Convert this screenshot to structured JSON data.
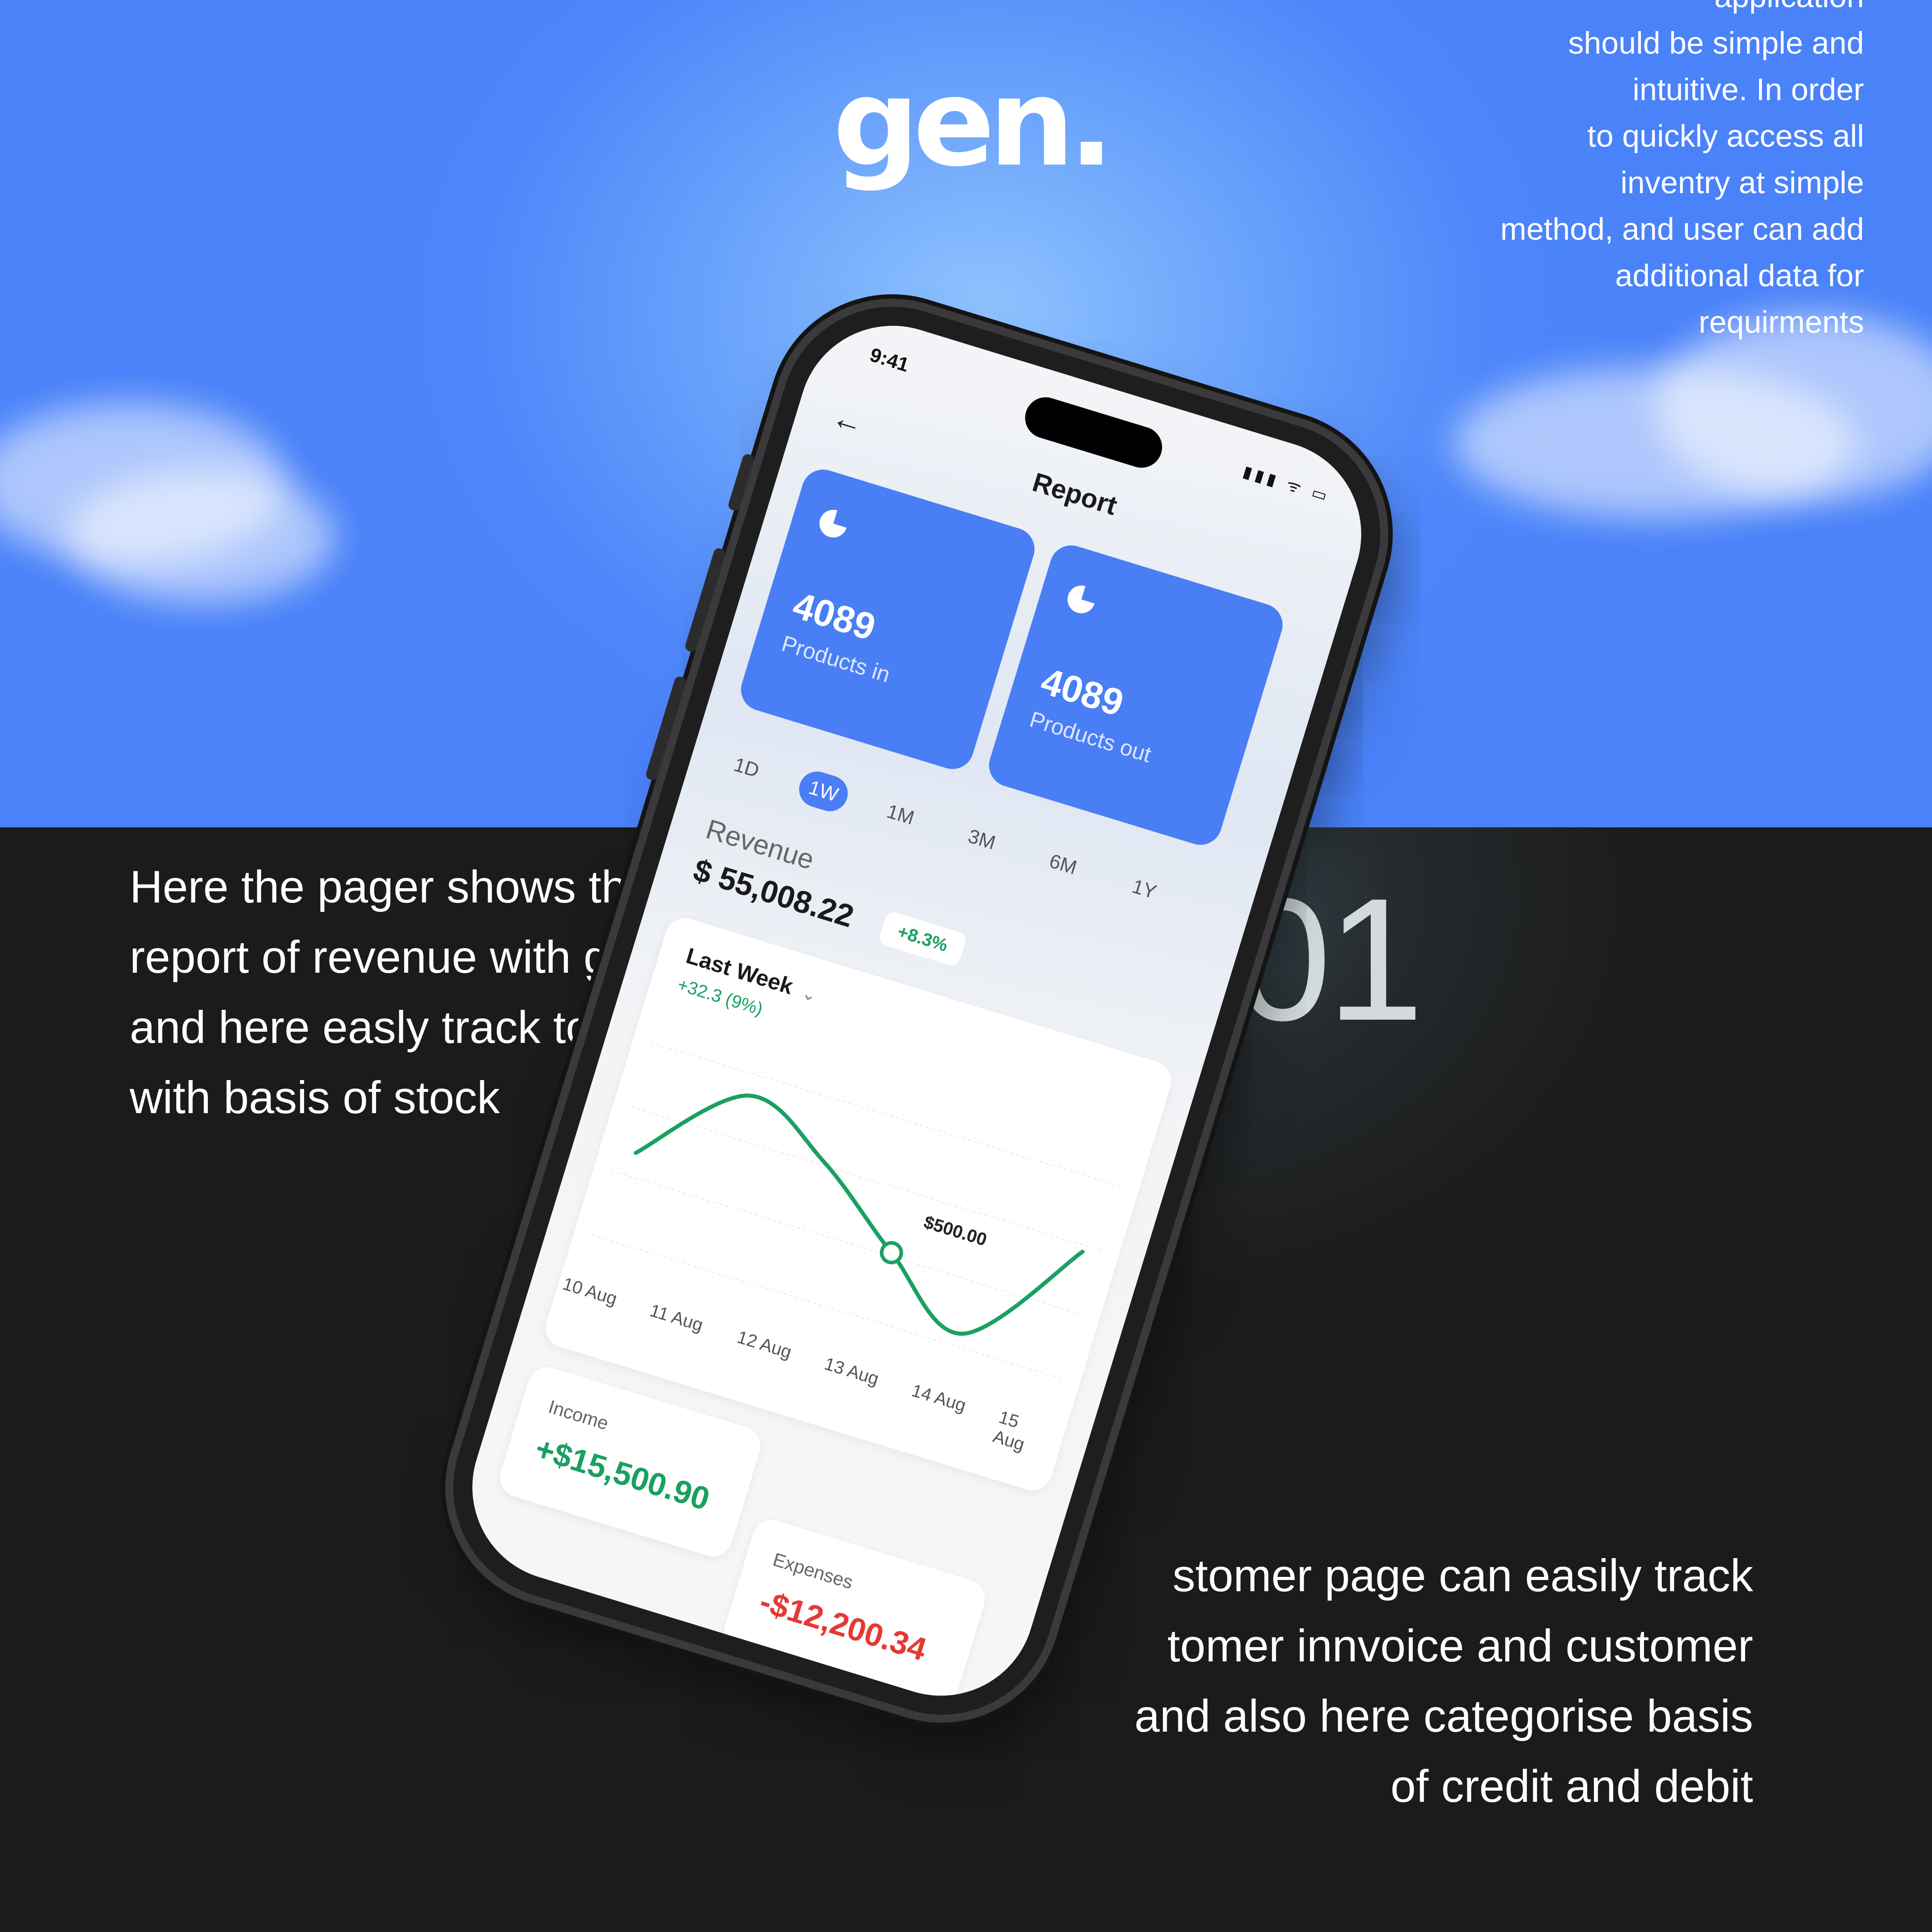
{
  "brand": {
    "logo_text": "gen."
  },
  "intro_blurb": {
    "lines": [
      "application",
      "should be simple and",
      "intuitive. In order",
      "to quickly access all",
      "inventry at  simple",
      "method, and user can add",
      "additional data for",
      "requirments"
    ]
  },
  "left_text": {
    "lines": [
      "Here the pager shows th",
      "report of revenue with g",
      "and here easly track to",
      "with basis of stock"
    ]
  },
  "right_text": {
    "lines": [
      "stomer page can easily track",
      "tomer innvoice and customer",
      "and also here categorise basis",
      "of credit and debit"
    ]
  },
  "section_number": "01",
  "phone": {
    "status": {
      "time": "9:41",
      "icons": "▮▮▮ ᯤ ▭"
    },
    "back_icon": "←",
    "title": "Report",
    "cards": [
      {
        "value": "4089",
        "label": "Products in"
      },
      {
        "value": "4089",
        "label": "Products out"
      }
    ],
    "tabs": [
      "1D",
      "1W",
      "1M",
      "3M",
      "6M",
      "1Y"
    ],
    "active_tab": "1W",
    "revenue": {
      "label": "Revenue",
      "value": "$ 55,008.22",
      "change": "+8.3%"
    },
    "chart": {
      "period_label": "Last Week",
      "change_text": "+32.3 (9%)",
      "highlight_label": "$500.00",
      "accent_color": "#1aa061"
    },
    "summary": {
      "income_label": "Income",
      "income_value": "+$15,500.90",
      "expenses_label": "Expenses",
      "expenses_value": "-$12,200.34",
      "income_color": "#1aa061",
      "expenses_color": "#e53935"
    }
  },
  "chart_data": {
    "type": "line",
    "x": [
      "10 Aug",
      "11 Aug",
      "12 Aug",
      "13 Aug",
      "14 Aug",
      "15 Aug"
    ],
    "series": [
      {
        "values": [
          470,
          640,
          560,
          430,
          320,
          540
        ]
      }
    ],
    "highlight": {
      "x": "13 Aug",
      "label": "$500.00"
    }
  }
}
